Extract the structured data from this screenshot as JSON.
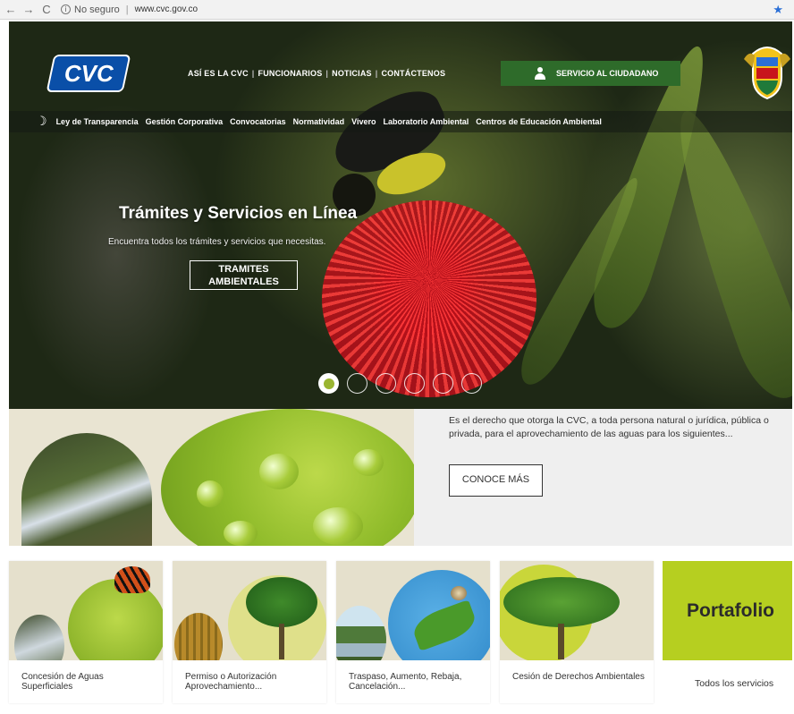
{
  "browser": {
    "security_label": "No seguro",
    "url": "www.cvc.gov.co",
    "back": "←",
    "forward": "→",
    "reload": "C"
  },
  "header": {
    "logo_text": "CVC",
    "nav": [
      "ASÍ ES LA CVC",
      "FUNCIONARIOS",
      "NOTICIAS",
      "CONTÁCTENOS"
    ],
    "servicio_label": "SERVICIO AL CIUDADANO",
    "subnav": [
      "Ley de Transparencia",
      "Gestión Corporativa",
      "Convocatorias",
      "Normatividad",
      "Vivero",
      "Laboratorio Ambiental",
      "Centros de Educación Ambiental"
    ]
  },
  "hero": {
    "title": "Trámites y Servicios en Línea",
    "subtitle": "Encuentra todos los trámites y servicios que necesitas.",
    "button_line1": "TRAMITES",
    "button_line2": "AMBIENTALES",
    "slide_count": 6,
    "active_slide": 1
  },
  "feature": {
    "text": "Es el derecho que otorga la CVC, a toda persona natural o jurídica, pública o privada, para el aprovechamiento de las aguas para los siguientes...",
    "button": "CONOCE MÁS"
  },
  "cards": [
    {
      "label": "Concesión de Aguas Superficiales"
    },
    {
      "label": "Permiso o Autorización Aprovechamiento..."
    },
    {
      "label": "Traspaso, Aumento, Rebaja, Cancelación..."
    },
    {
      "label": "Cesión de Derechos Ambientales"
    }
  ],
  "portafolio": {
    "title": "Portafolio",
    "link": "Todos los servicios"
  },
  "colors": {
    "accent_green": "#2e6b2a",
    "lime": "#b6cf20",
    "logo_blue": "#0a4fa8"
  }
}
